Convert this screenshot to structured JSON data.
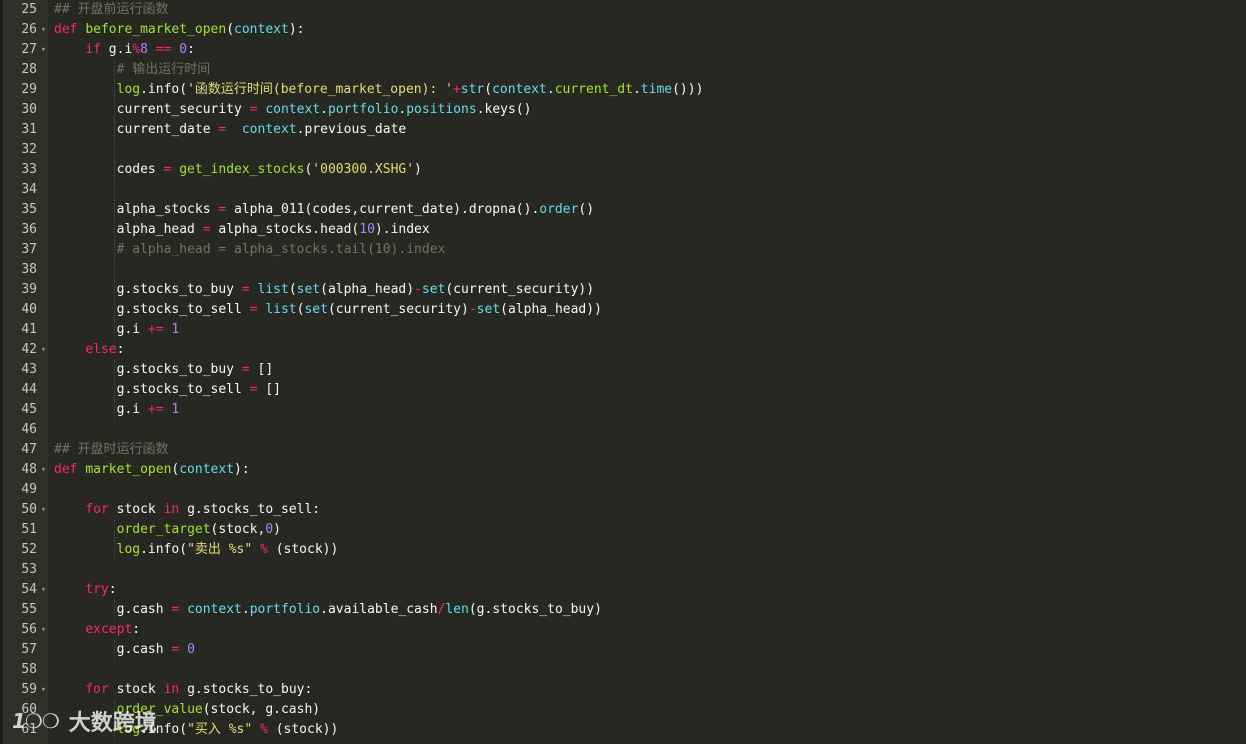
{
  "theme": {
    "background": "#272822",
    "gutter": "#2f3129",
    "keyword": "#f92672",
    "function": "#a6e22e",
    "builtin": "#66d9ef",
    "number": "#ae81ff",
    "string": "#e6db74",
    "comment": "#75715e",
    "text": "#f8f8f2"
  },
  "watermark": {
    "logo": "1❍❍",
    "text": "大数跨境"
  },
  "lines": [
    {
      "n": "25",
      "fold": false,
      "guides": 0,
      "tokens": [
        [
          "cm",
          "## 开盘前运行函数"
        ]
      ]
    },
    {
      "n": "26",
      "fold": true,
      "guides": 0,
      "tokens": [
        [
          "kw",
          "def"
        ],
        [
          "",
          " "
        ],
        [
          "fn",
          "before_market_open"
        ],
        [
          "",
          "("
        ],
        [
          "bi",
          "context"
        ],
        [
          "",
          "):"
        ]
      ]
    },
    {
      "n": "27",
      "fold": true,
      "guides": 0,
      "tokens": [
        [
          "",
          "    "
        ],
        [
          "kw",
          "if"
        ],
        [
          "",
          " g.i"
        ],
        [
          "op",
          "%"
        ],
        [
          "num",
          "8"
        ],
        [
          "",
          " "
        ],
        [
          "op",
          "=="
        ],
        [
          "",
          " "
        ],
        [
          "num",
          "0"
        ],
        [
          "",
          ":"
        ]
      ]
    },
    {
      "n": "28",
      "fold": false,
      "guides": 2,
      "tokens": [
        [
          "",
          "        "
        ],
        [
          "cm",
          "# 输出运行时间"
        ]
      ]
    },
    {
      "n": "29",
      "fold": false,
      "guides": 2,
      "tokens": [
        [
          "",
          "        "
        ],
        [
          "fn",
          "log"
        ],
        [
          "",
          ".info("
        ],
        [
          "str",
          "'函数运行时间(before_market_open): '"
        ],
        [
          "op",
          "+"
        ],
        [
          "bi",
          "str"
        ],
        [
          "",
          "("
        ],
        [
          "bi",
          "context"
        ],
        [
          "",
          "."
        ],
        [
          "fn",
          "current_dt"
        ],
        [
          "",
          "."
        ],
        [
          "bi",
          "time"
        ],
        [
          "",
          "()))"
        ]
      ]
    },
    {
      "n": "30",
      "fold": false,
      "guides": 2,
      "tokens": [
        [
          "",
          "        current_security "
        ],
        [
          "op",
          "="
        ],
        [
          "",
          " "
        ],
        [
          "bi",
          "context"
        ],
        [
          "",
          "."
        ],
        [
          "bi",
          "portfolio"
        ],
        [
          "",
          "."
        ],
        [
          "bi",
          "positions"
        ],
        [
          "",
          ".keys()"
        ]
      ]
    },
    {
      "n": "31",
      "fold": false,
      "guides": 2,
      "tokens": [
        [
          "",
          "        current_date "
        ],
        [
          "op",
          "="
        ],
        [
          "",
          "  "
        ],
        [
          "bi",
          "context"
        ],
        [
          "",
          ".previous_date"
        ]
      ]
    },
    {
      "n": "32",
      "fold": false,
      "guides": 2,
      "tokens": [
        [
          "",
          ""
        ]
      ]
    },
    {
      "n": "33",
      "fold": false,
      "guides": 2,
      "tokens": [
        [
          "",
          "        codes "
        ],
        [
          "op",
          "="
        ],
        [
          "",
          " "
        ],
        [
          "fn",
          "get_index_stocks"
        ],
        [
          "",
          "("
        ],
        [
          "str",
          "'000300.XSHG'"
        ],
        [
          "",
          ")"
        ]
      ]
    },
    {
      "n": "34",
      "fold": false,
      "guides": 2,
      "tokens": [
        [
          "",
          ""
        ]
      ]
    },
    {
      "n": "35",
      "fold": false,
      "guides": 2,
      "tokens": [
        [
          "",
          "        alpha_stocks "
        ],
        [
          "op",
          "="
        ],
        [
          "",
          " alpha_011(codes,current_date).dropna()."
        ],
        [
          "bi",
          "order"
        ],
        [
          "",
          "()"
        ]
      ]
    },
    {
      "n": "36",
      "fold": false,
      "guides": 2,
      "tokens": [
        [
          "",
          "        alpha_head "
        ],
        [
          "op",
          "="
        ],
        [
          "",
          " alpha_stocks.head("
        ],
        [
          "num",
          "10"
        ],
        [
          "",
          ").index"
        ]
      ]
    },
    {
      "n": "37",
      "fold": false,
      "guides": 2,
      "tokens": [
        [
          "",
          "        "
        ],
        [
          "cm",
          "# alpha_head = alpha_stocks.tail(10).index"
        ]
      ]
    },
    {
      "n": "38",
      "fold": false,
      "guides": 2,
      "tokens": [
        [
          "",
          ""
        ]
      ]
    },
    {
      "n": "39",
      "fold": false,
      "guides": 2,
      "tokens": [
        [
          "",
          "        g.stocks_to_buy "
        ],
        [
          "op",
          "="
        ],
        [
          "",
          " "
        ],
        [
          "bi",
          "list"
        ],
        [
          "",
          "("
        ],
        [
          "bi",
          "set"
        ],
        [
          "",
          "(alpha_head)"
        ],
        [
          "op",
          "-"
        ],
        [
          "bi",
          "set"
        ],
        [
          "",
          "(current_security))"
        ]
      ]
    },
    {
      "n": "40",
      "fold": false,
      "guides": 2,
      "tokens": [
        [
          "",
          "        g.stocks_to_sell "
        ],
        [
          "op",
          "="
        ],
        [
          "",
          " "
        ],
        [
          "bi",
          "list"
        ],
        [
          "",
          "("
        ],
        [
          "bi",
          "set"
        ],
        [
          "",
          "(current_security)"
        ],
        [
          "op",
          "-"
        ],
        [
          "bi",
          "set"
        ],
        [
          "",
          "(alpha_head))"
        ]
      ]
    },
    {
      "n": "41",
      "fold": false,
      "guides": 2,
      "tokens": [
        [
          "",
          "        g.i "
        ],
        [
          "op",
          "+="
        ],
        [
          "",
          " "
        ],
        [
          "num",
          "1"
        ]
      ]
    },
    {
      "n": "42",
      "fold": true,
      "guides": 0,
      "tokens": [
        [
          "",
          "    "
        ],
        [
          "kw",
          "else"
        ],
        [
          "",
          ":"
        ]
      ]
    },
    {
      "n": "43",
      "fold": false,
      "guides": 2,
      "tokens": [
        [
          "",
          "        g.stocks_to_buy "
        ],
        [
          "op",
          "="
        ],
        [
          "",
          " []"
        ]
      ]
    },
    {
      "n": "44",
      "fold": false,
      "guides": 2,
      "tokens": [
        [
          "",
          "        g.stocks_to_sell "
        ],
        [
          "op",
          "="
        ],
        [
          "",
          " []"
        ]
      ]
    },
    {
      "n": "45",
      "fold": false,
      "guides": 2,
      "tokens": [
        [
          "",
          "        g.i "
        ],
        [
          "op",
          "+="
        ],
        [
          "",
          " "
        ],
        [
          "num",
          "1"
        ]
      ]
    },
    {
      "n": "46",
      "fold": false,
      "guides": 0,
      "tokens": [
        [
          "",
          ""
        ]
      ]
    },
    {
      "n": "47",
      "fold": false,
      "guides": 0,
      "tokens": [
        [
          "cm",
          "## 开盘时运行函数"
        ]
      ]
    },
    {
      "n": "48",
      "fold": true,
      "guides": 0,
      "tokens": [
        [
          "kw",
          "def"
        ],
        [
          "",
          " "
        ],
        [
          "fn",
          "market_open"
        ],
        [
          "",
          "("
        ],
        [
          "bi",
          "context"
        ],
        [
          "",
          "):"
        ]
      ]
    },
    {
      "n": "49",
      "fold": false,
      "guides": 0,
      "tokens": [
        [
          "",
          ""
        ]
      ]
    },
    {
      "n": "50",
      "fold": true,
      "guides": 0,
      "tokens": [
        [
          "",
          "    "
        ],
        [
          "kw",
          "for"
        ],
        [
          "",
          " stock "
        ],
        [
          "kw",
          "in"
        ],
        [
          "",
          " g.stocks_to_sell:"
        ]
      ]
    },
    {
      "n": "51",
      "fold": false,
      "guides": 2,
      "tokens": [
        [
          "",
          "        "
        ],
        [
          "fn",
          "order_target"
        ],
        [
          "",
          "(stock,"
        ],
        [
          "num",
          "0"
        ],
        [
          "",
          ")"
        ]
      ]
    },
    {
      "n": "52",
      "fold": false,
      "guides": 2,
      "tokens": [
        [
          "",
          "        "
        ],
        [
          "fn",
          "log"
        ],
        [
          "",
          ".info("
        ],
        [
          "str",
          "\"卖出 %s\""
        ],
        [
          "",
          " "
        ],
        [
          "op",
          "%"
        ],
        [
          "",
          " (stock))"
        ]
      ]
    },
    {
      "n": "53",
      "fold": false,
      "guides": 0,
      "tokens": [
        [
          "",
          ""
        ]
      ]
    },
    {
      "n": "54",
      "fold": true,
      "guides": 0,
      "tokens": [
        [
          "",
          "    "
        ],
        [
          "kw",
          "try"
        ],
        [
          "",
          ":"
        ]
      ]
    },
    {
      "n": "55",
      "fold": false,
      "guides": 2,
      "tokens": [
        [
          "",
          "        g.cash "
        ],
        [
          "op",
          "="
        ],
        [
          "",
          " "
        ],
        [
          "bi",
          "context"
        ],
        [
          "",
          "."
        ],
        [
          "bi",
          "portfolio"
        ],
        [
          "",
          ".available_cash"
        ],
        [
          "op",
          "/"
        ],
        [
          "bi",
          "len"
        ],
        [
          "",
          "(g.stocks_to_buy)"
        ]
      ]
    },
    {
      "n": "56",
      "fold": true,
      "guides": 0,
      "tokens": [
        [
          "",
          "    "
        ],
        [
          "kw",
          "except"
        ],
        [
          "",
          ":"
        ]
      ]
    },
    {
      "n": "57",
      "fold": false,
      "guides": 2,
      "tokens": [
        [
          "",
          "        g.cash "
        ],
        [
          "op",
          "="
        ],
        [
          "",
          " "
        ],
        [
          "num",
          "0"
        ]
      ]
    },
    {
      "n": "58",
      "fold": false,
      "guides": 0,
      "tokens": [
        [
          "",
          ""
        ]
      ]
    },
    {
      "n": "59",
      "fold": true,
      "guides": 0,
      "tokens": [
        [
          "",
          "    "
        ],
        [
          "kw",
          "for"
        ],
        [
          "",
          " stock "
        ],
        [
          "kw",
          "in"
        ],
        [
          "",
          " g.stocks_to_buy:"
        ]
      ]
    },
    {
      "n": "60",
      "fold": false,
      "guides": 2,
      "tokens": [
        [
          "",
          "        "
        ],
        [
          "fn",
          "order_value"
        ],
        [
          "",
          "(stock, g.cash)"
        ]
      ]
    },
    {
      "n": "61",
      "fold": false,
      "guides": 2,
      "tokens": [
        [
          "",
          "        "
        ],
        [
          "fn",
          "log"
        ],
        [
          "",
          ".info("
        ],
        [
          "str",
          "\"买入 %s\""
        ],
        [
          "",
          " "
        ],
        [
          "op",
          "%"
        ],
        [
          "",
          " (stock))"
        ]
      ]
    }
  ]
}
